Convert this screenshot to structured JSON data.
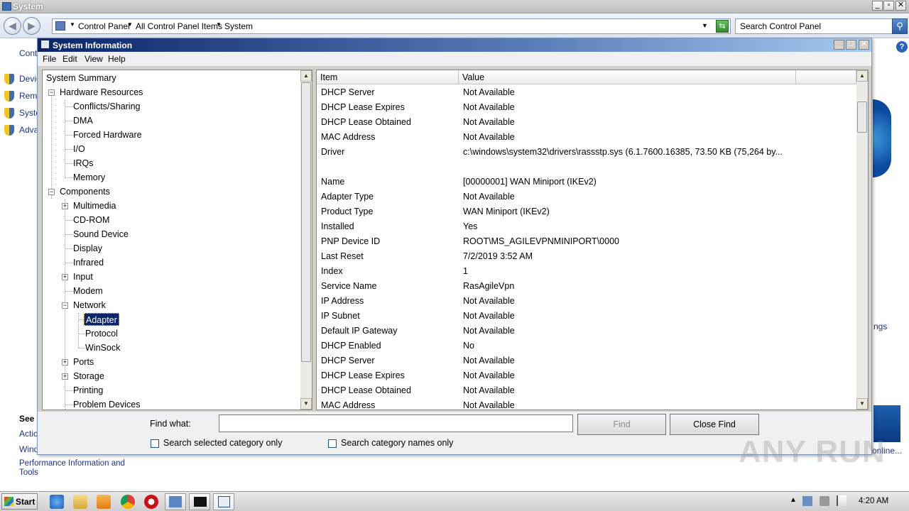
{
  "outer_window": {
    "title": "System",
    "controls": {
      "minimize": "_",
      "maximize": "▫",
      "close": "✕"
    }
  },
  "address_bar": {
    "crumbs": [
      "Control Panel",
      "All Control Panel Items",
      "System"
    ],
    "search_placeholder": "Search Control Panel"
  },
  "control_panel": {
    "left_label": "Contr",
    "tasks": [
      "Devic",
      "Remo",
      "Syste",
      "Adva"
    ],
    "see_also_heading": "See",
    "see_also": [
      "Actic",
      "Wind",
      "Performance Information and",
      "Tools"
    ],
    "right_fragments": {
      "settings": "ngs",
      "online": "online..."
    }
  },
  "sysinfo": {
    "title": "System Information",
    "menu": [
      "File",
      "Edit",
      "View",
      "Help"
    ],
    "tree": {
      "root": "System Summary",
      "hardware": "Hardware Resources",
      "hardware_items": [
        "Conflicts/Sharing",
        "DMA",
        "Forced Hardware",
        "I/O",
        "IRQs",
        "Memory"
      ],
      "components": "Components",
      "component_items": [
        "Multimedia",
        "CD-ROM",
        "Sound Device",
        "Display",
        "Infrared",
        "Input",
        "Modem",
        "Network"
      ],
      "network_items": [
        "Adapter",
        "Protocol",
        "WinSock"
      ],
      "after_items": [
        "Ports",
        "Storage",
        "Printing",
        "Problem Devices"
      ],
      "plus": "+",
      "minus": "−"
    },
    "columns": {
      "item": "Item",
      "value": "Value"
    },
    "rows": [
      {
        "item": "DHCP Server",
        "value": "Not Available"
      },
      {
        "item": "DHCP Lease Expires",
        "value": "Not Available"
      },
      {
        "item": "DHCP Lease Obtained",
        "value": "Not Available"
      },
      {
        "item": "MAC Address",
        "value": "Not Available"
      },
      {
        "item": "Driver",
        "value": "c:\\windows\\system32\\drivers\\rassstp.sys (6.1.7600.16385, 73.50 KB (75,264 by..."
      },
      {
        "item": "",
        "value": ""
      },
      {
        "item": "Name",
        "value": "[00000001] WAN Miniport (IKEv2)"
      },
      {
        "item": "Adapter Type",
        "value": "Not Available"
      },
      {
        "item": "Product Type",
        "value": "WAN Miniport (IKEv2)"
      },
      {
        "item": "Installed",
        "value": "Yes"
      },
      {
        "item": "PNP Device ID",
        "value": "ROOT\\MS_AGILEVPNMINIPORT\\0000"
      },
      {
        "item": "Last Reset",
        "value": "7/2/2019 3:52 AM"
      },
      {
        "item": "Index",
        "value": "1"
      },
      {
        "item": "Service Name",
        "value": "RasAgileVpn"
      },
      {
        "item": "IP Address",
        "value": "Not Available"
      },
      {
        "item": "IP Subnet",
        "value": "Not Available"
      },
      {
        "item": "Default IP Gateway",
        "value": "Not Available"
      },
      {
        "item": "DHCP Enabled",
        "value": "No"
      },
      {
        "item": "DHCP Server",
        "value": "Not Available"
      },
      {
        "item": "DHCP Lease Expires",
        "value": "Not Available"
      },
      {
        "item": "DHCP Lease Obtained",
        "value": "Not Available"
      },
      {
        "item": "MAC Address",
        "value": "Not Available"
      }
    ],
    "find": {
      "label": "Find what:",
      "value": "",
      "find_button": "Find",
      "close_button": "Close Find",
      "chk_selected": "Search selected category only",
      "chk_names": "Search category names only"
    }
  },
  "taskbar": {
    "start": "Start",
    "clock": "4:20 AM"
  },
  "watermark": "ANY RUN"
}
